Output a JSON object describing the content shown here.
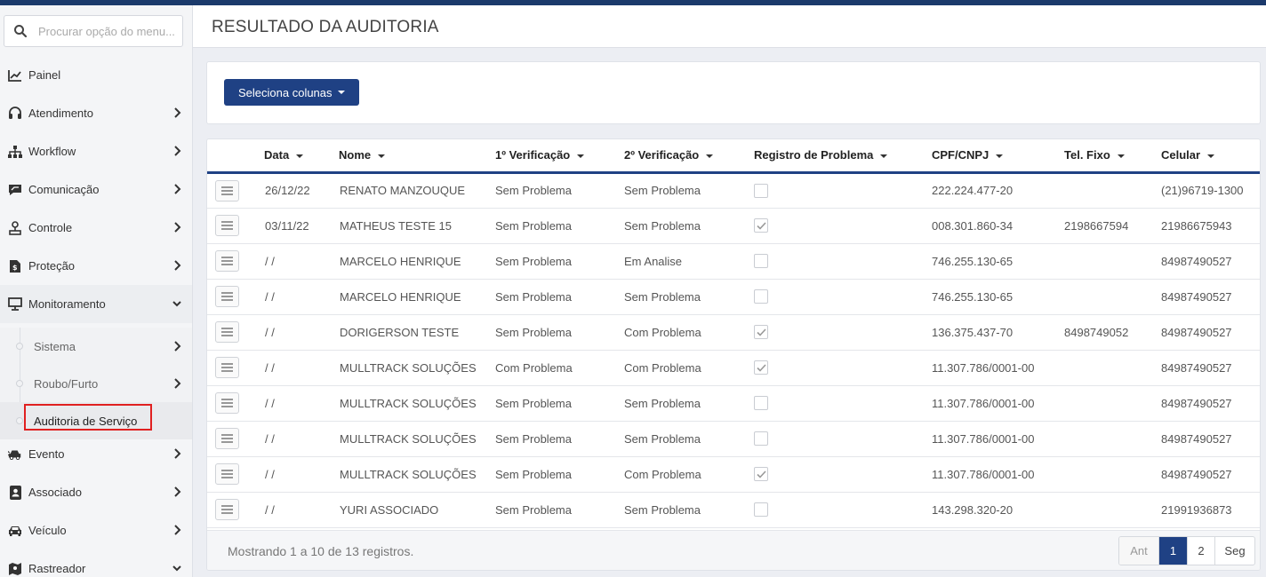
{
  "sidebar": {
    "search_placeholder": "Procurar opção do menu...",
    "items": [
      {
        "label": "Painel",
        "icon": "chart-line-icon",
        "chevron": "none"
      },
      {
        "label": "Atendimento",
        "icon": "headset-icon",
        "chevron": "right"
      },
      {
        "label": "Workflow",
        "icon": "sitemap-icon",
        "chevron": "right"
      },
      {
        "label": "Comunicação",
        "icon": "message-icon",
        "chevron": "right"
      },
      {
        "label": "Controle",
        "icon": "person-icon",
        "chevron": "right"
      },
      {
        "label": "Proteção",
        "icon": "document-icon",
        "chevron": "right"
      },
      {
        "label": "Monitoramento",
        "icon": "monitor-icon",
        "chevron": "down"
      }
    ],
    "submenu": [
      {
        "label": "Sistema",
        "chevron": "right"
      },
      {
        "label": "Roubo/Furto",
        "chevron": "right"
      },
      {
        "label": "Auditoria de Serviço",
        "chevron": "none"
      }
    ],
    "items_after": [
      {
        "label": "Evento",
        "icon": "car-crash-icon",
        "chevron": "right"
      },
      {
        "label": "Associado",
        "icon": "id-badge-icon",
        "chevron": "right"
      },
      {
        "label": "Veículo",
        "icon": "car-icon",
        "chevron": "right"
      },
      {
        "label": "Rastreador",
        "icon": "map-icon",
        "chevron": "down"
      }
    ]
  },
  "header": {
    "title": "RESULTADO DA AUDITORIA"
  },
  "toolbar": {
    "columns_button": "Seleciona colunas"
  },
  "table": {
    "columns": [
      "Data",
      "Nome",
      "1º Verificação",
      "2º Verificação",
      "Registro de Problema",
      "CPF/CNPJ",
      "Tel. Fixo",
      "Celular"
    ],
    "rows": [
      {
        "data": "26/12/22",
        "nome": "RENATO MANZOUQUE",
        "v1": "Sem Problema",
        "v2": "Sem Problema",
        "registro": false,
        "cpf": "222.224.477-20",
        "tel": "",
        "cel": "(21)96719-1300"
      },
      {
        "data": "03/11/22",
        "nome": "MATHEUS TESTE 15",
        "v1": "Sem Problema",
        "v2": "Sem Problema",
        "registro": true,
        "cpf": "008.301.860-34",
        "tel": "2198667594",
        "cel": "21986675943"
      },
      {
        "data": "/ /",
        "nome": "MARCELO HENRIQUE",
        "v1": "Sem Problema",
        "v2": "Em Analise",
        "registro": false,
        "cpf": "746.255.130-65",
        "tel": "",
        "cel": "84987490527"
      },
      {
        "data": "/ /",
        "nome": "MARCELO HENRIQUE",
        "v1": "Sem Problema",
        "v2": "Sem Problema",
        "registro": false,
        "cpf": "746.255.130-65",
        "tel": "",
        "cel": "84987490527"
      },
      {
        "data": "/ /",
        "nome": "DORIGERSON TESTE",
        "v1": "Sem Problema",
        "v2": "Com Problema",
        "registro": true,
        "cpf": "136.375.437-70",
        "tel": "8498749052",
        "cel": "84987490527"
      },
      {
        "data": "/ /",
        "nome": "MULLTRACK SOLUÇÕES",
        "v1": "Com Problema",
        "v2": "Com Problema",
        "registro": true,
        "cpf": "11.307.786/0001-00",
        "tel": "",
        "cel": "84987490527"
      },
      {
        "data": "/ /",
        "nome": "MULLTRACK SOLUÇÕES",
        "v1": "Sem Problema",
        "v2": "Sem Problema",
        "registro": false,
        "cpf": "11.307.786/0001-00",
        "tel": "",
        "cel": "84987490527"
      },
      {
        "data": "/ /",
        "nome": "MULLTRACK SOLUÇÕES",
        "v1": "Sem Problema",
        "v2": "Sem Problema",
        "registro": false,
        "cpf": "11.307.786/0001-00",
        "tel": "",
        "cel": "84987490527"
      },
      {
        "data": "/ /",
        "nome": "MULLTRACK SOLUÇÕES",
        "v1": "Sem Problema",
        "v2": "Com Problema",
        "registro": true,
        "cpf": "11.307.786/0001-00",
        "tel": "",
        "cel": "84987490527"
      },
      {
        "data": "/ /",
        "nome": "YURI ASSOCIADO",
        "v1": "Sem Problema",
        "v2": "Sem Problema",
        "registro": false,
        "cpf": "143.298.320-20",
        "tel": "",
        "cel": "21991936873"
      }
    ]
  },
  "footer": {
    "info": "Mostrando 1 a 10 de 13 registros.",
    "pagination": {
      "prev": "Ant",
      "pages": [
        "1",
        "2"
      ],
      "current": "1",
      "next": "Seg"
    }
  },
  "colors": {
    "brand": "#1f4184",
    "topbar": "#1b3a6b",
    "highlight": "#e02020"
  }
}
